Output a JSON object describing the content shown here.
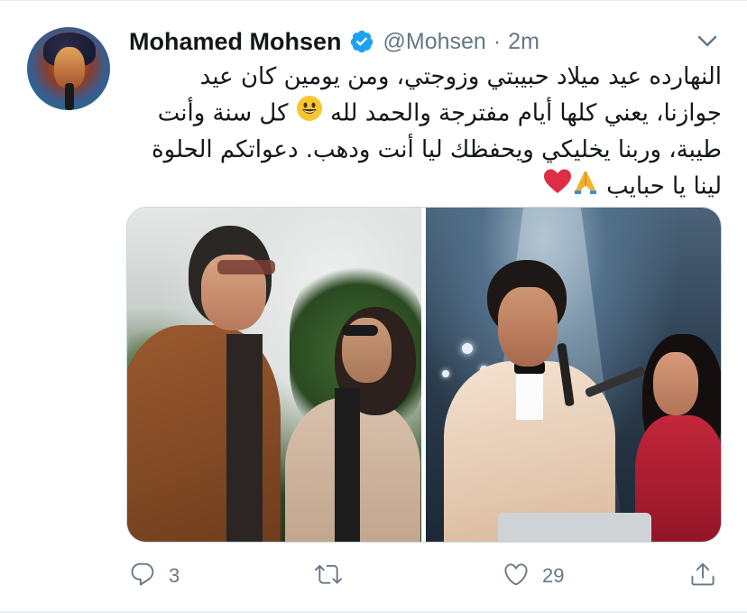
{
  "tweet": {
    "author_name": "Mohamed Mohsen",
    "handle": "@Mohsen",
    "separator": "·",
    "time": "2m",
    "text_lines": [
      "النهارده عيد ميلاد حبيبتي وزوجتي، ومن يومين كان عيد",
      "جوازنا، يعني كلها أيام مفترجة والحمد لله",
      "كل سنة وأنت",
      "طيبة، وربنا يخليكي ويحفظك ليا أنت ودهب. دعواتكم الحلوة",
      "لينا يا حبايب"
    ]
  },
  "icons": {
    "verified": "verified-badge-icon",
    "caret": "chevron-down-icon",
    "reply": "reply-icon",
    "retweet": "retweet-icon",
    "like": "heart-icon",
    "share": "share-icon",
    "emoji_smile": "smiling-face-emoji",
    "emoji_pray": "folded-hands-emoji",
    "emoji_heart": "red-heart-emoji"
  },
  "actions": {
    "reply_count": "3",
    "retweet_count": "",
    "like_count": "29"
  },
  "colors": {
    "text": "#14171a",
    "secondary": "#657786",
    "verified_blue": "#1da1f2",
    "border": "#ccd6dd"
  }
}
